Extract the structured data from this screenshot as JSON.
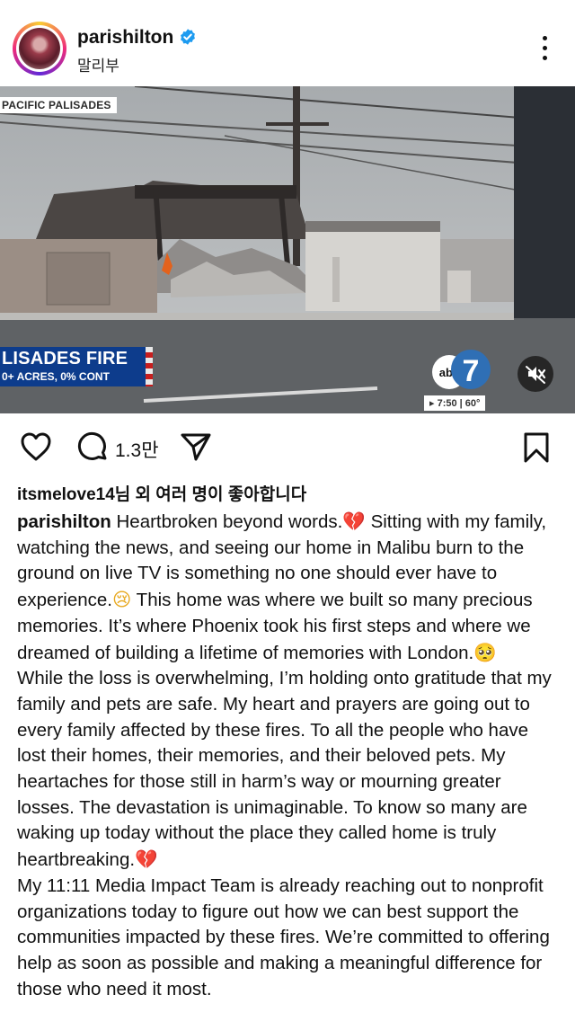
{
  "post": {
    "username": "parishilton",
    "location": "말리부"
  },
  "media": {
    "location_label": "PACIFIC PALISADES",
    "banner_title": "LISADES FIRE",
    "banner_subtitle": "0+ ACRES, 0% CONT",
    "station_logo": "abc7",
    "timestamp": "▸ 7:50 | 60°",
    "muted": true
  },
  "actions": {
    "comment_count": "1.3만"
  },
  "likes": {
    "text": "itsmelove14님 외 여러 명이 좋아합니다"
  },
  "caption": {
    "author": "parishilton",
    "p1_a": "Heartbroken beyond words.",
    "p1_b": " Sitting with my family, watching the news, and seeing our home in Malibu burn to the ground on live TV is something no one should ever have to experience.",
    "p1_c": " This home was where we built so many precious memories. It’s where Phoenix took his first steps and where we dreamed of building a lifetime of memories with London.",
    "p2_a": "While the loss is overwhelming, I’m holding onto gratitude that my family and pets are safe. My heart and prayers are going out to every family affected by these fires. To all the people who have lost their homes, their memories, and their beloved pets. My heartaches for those still in harm’s way or mourning greater losses. The devastation is unimaginable. To know so many are waking up today without the place they called home is truly heartbreaking.",
    "p3": "My 11:11 Media Impact Team is already reaching out to nonprofit organizations today to figure out how we can best support the communities impacted by these fires. We’re committed to offering help as soon as possible and making a meaningful difference for those who need it most."
  },
  "icons": {
    "verified": "verified-badge-icon",
    "more": "more-options-icon",
    "like": "heart-icon",
    "comment": "comment-icon",
    "share": "paper-plane-icon",
    "save": "bookmark-icon",
    "mute": "speaker-muted-icon"
  },
  "colors": {
    "verified_blue": "#1d9bf0",
    "news_banner": "#0d3c8c",
    "broken_heart": "#d63a66"
  }
}
